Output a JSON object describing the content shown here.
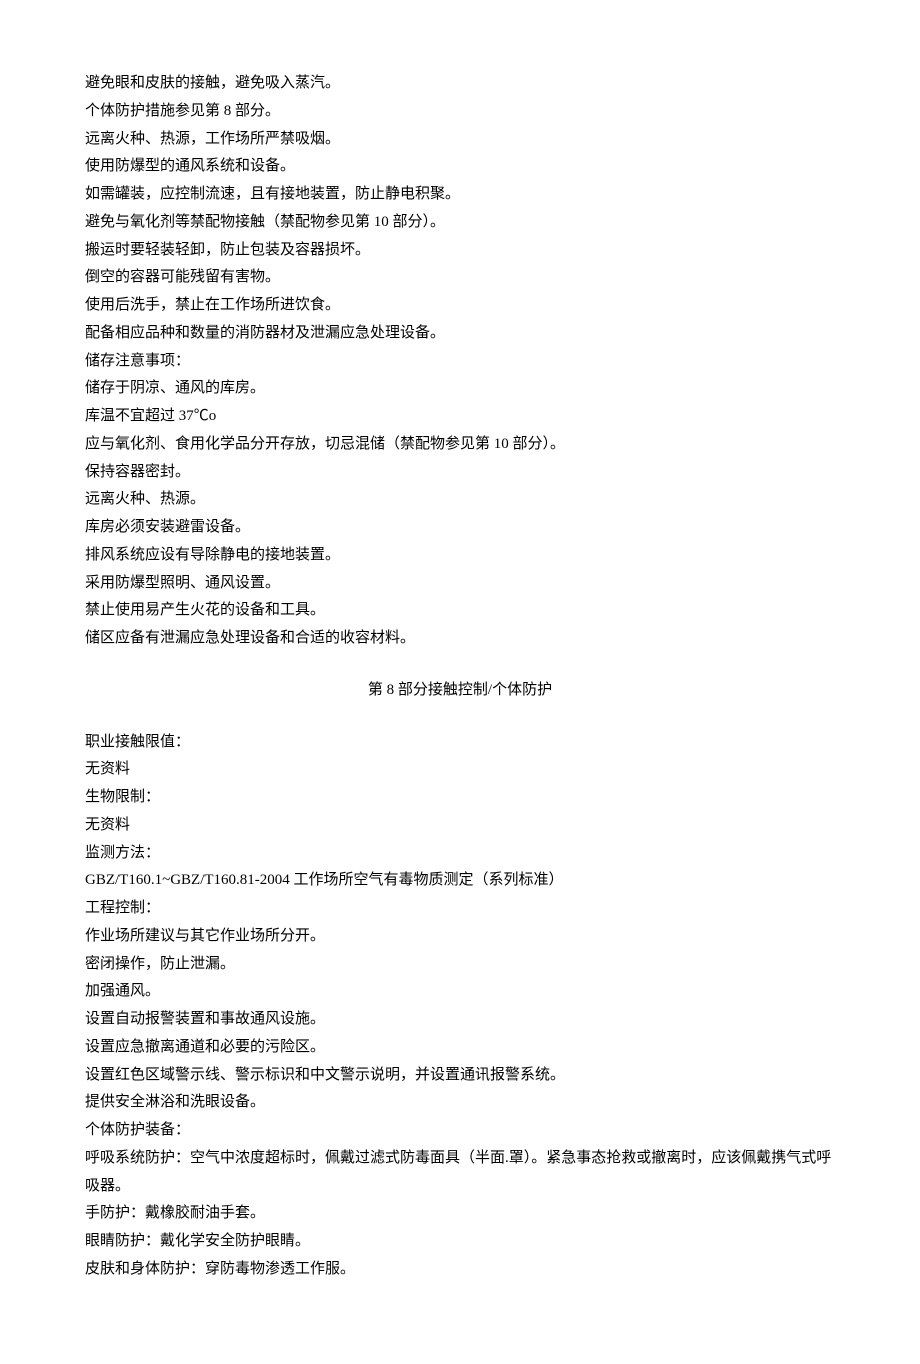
{
  "section7": {
    "lines": [
      "避免眼和皮肤的接触，避免吸入蒸汽。",
      "个体防护措施参见第 8 部分。",
      "远离火种、热源，工作场所严禁吸烟。",
      "使用防爆型的通风系统和设备。",
      "如需罐装，应控制流速，且有接地装置，防止静电积聚。",
      "避免与氧化剂等禁配物接触（禁配物参见第 10 部分）。",
      "搬运时要轻装轻卸，防止包装及容器损坏。",
      "倒空的容器可能残留有害物。",
      "使用后洗手，禁止在工作场所进饮食。",
      "配备相应品种和数量的消防器材及泄漏应急处理设备。",
      "储存注意事项：",
      "储存于阴凉、通风的库房。",
      "库温不宜超过 37℃o",
      "应与氧化剂、食用化学品分开存放，切忌混储（禁配物参见第 10 部分）。",
      "保持容器密封。",
      "远离火种、热源。",
      "库房必须安装避雷设备。",
      "排风系统应设有导除静电的接地装置。",
      "采用防爆型照明、通风设置。",
      "禁止使用易产生火花的设备和工具。",
      "储区应备有泄漏应急处理设备和合适的收容材料。"
    ]
  },
  "section8": {
    "title": "第 8 部分接触控制/个体防护",
    "lines": [
      "职业接触限值：",
      "无资料",
      "生物限制：",
      "无资料",
      "监测方法：",
      "GBZ/T160.1~GBZ/T160.81-2004 工作场所空气有毒物质测定（系列标准）",
      "工程控制：",
      "作业场所建议与其它作业场所分开。",
      "密闭操作，防止泄漏。",
      "加强通风。",
      "设置自动报警装置和事故通风设施。",
      "设置应急撤离通道和必要的污险区。",
      "设置红色区域警示线、警示标识和中文警示说明，并设置通讯报警系统。",
      "提供安全淋浴和洗眼设备。",
      "个体防护装备：",
      "呼吸系统防护：空气中浓度超标时，佩戴过滤式防毒面具（半面.罩）。紧急事态抢救或撤离时，应该佩戴携气式呼吸器。",
      "手防护：戴橡胶耐油手套。",
      "眼睛防护：戴化学安全防护眼睛。",
      "皮肤和身体防护：穿防毒物渗透工作服。"
    ]
  }
}
